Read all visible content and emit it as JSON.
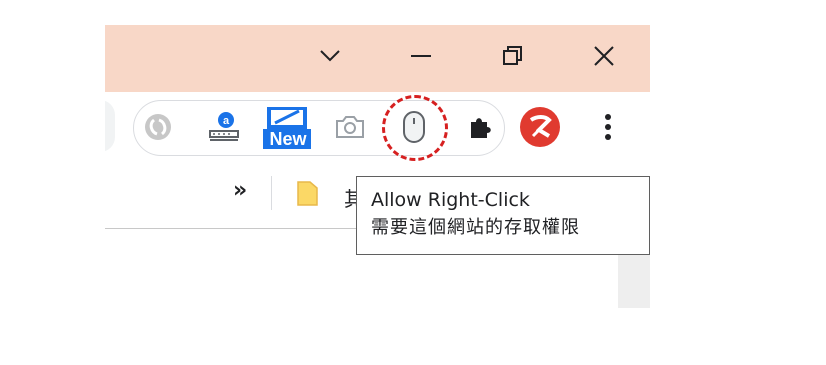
{
  "window_controls": {
    "dropdown_icon": "chevron-down-icon",
    "minimize_icon": "minimize-icon",
    "restore_icon": "restore-icon",
    "close_icon": "close-icon"
  },
  "toolbar": {
    "extensions": [
      {
        "name": "sync-extension",
        "icon": "swirl-icon"
      },
      {
        "name": "translate-extension",
        "icon": "translate-icon",
        "badge": "a"
      },
      {
        "name": "new-extension",
        "icon": "new-badge-icon",
        "badge": "New"
      },
      {
        "name": "screenshot-extension",
        "icon": "camera-icon"
      },
      {
        "name": "allow-right-click-extension",
        "icon": "mouse-icon"
      }
    ],
    "puzzle_icon": "puzzle-icon",
    "menu_icon": "more-vertical-icon"
  },
  "bookmarks": {
    "overflow_label": "»",
    "folder_icon": "folder-icon",
    "folder_label": "其"
  },
  "tooltip": {
    "title": "Allow Right-Click",
    "subtitle": "需要這個網站的存取權限"
  },
  "colors": {
    "titlebar": "#f8d7c7",
    "highlight_circle": "#d62020",
    "new_badge": "#1a73e8",
    "avatar": "#e03a2f"
  }
}
